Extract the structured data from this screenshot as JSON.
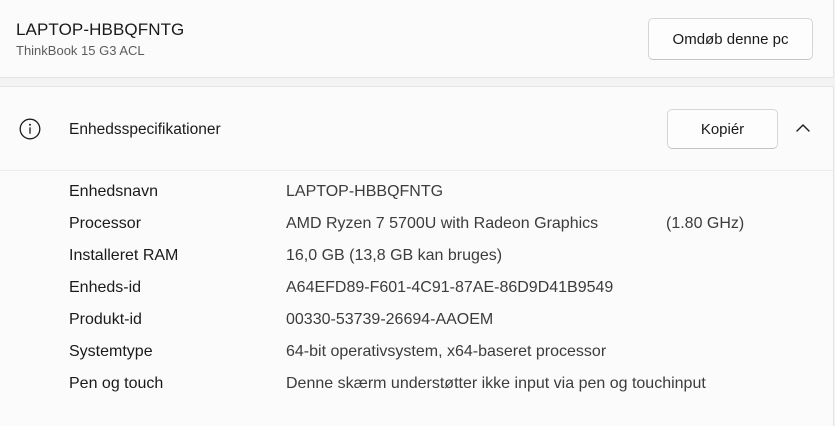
{
  "device": {
    "name": "LAPTOP-HBBQFNTG",
    "model": "ThinkBook 15 G3 ACL",
    "rename_label": "Omdøb denne pc"
  },
  "specs": {
    "title": "Enhedsspecifikationer",
    "info_icon": "info-icon",
    "copy_label": "Kopiér",
    "collapse_icon": "chevron-up-icon",
    "rows": [
      {
        "label": "Enhedsnavn",
        "value": "LAPTOP-HBBQFNTG",
        "extra": ""
      },
      {
        "label": "Processor",
        "value": "AMD Ryzen 7 5700U with Radeon Graphics",
        "extra": "(1.80 GHz)"
      },
      {
        "label": "Installeret RAM",
        "value": "16,0 GB (13,8 GB kan bruges)",
        "extra": ""
      },
      {
        "label": "Enheds-id",
        "value": "A64EFD89-F601-4C91-87AE-86D9D41B9549",
        "extra": ""
      },
      {
        "label": "Produkt-id",
        "value": "00330-53739-26694-AAOEM",
        "extra": ""
      },
      {
        "label": "Systemtype",
        "value": "64-bit operativsystem, x64-baseret processor",
        "extra": ""
      },
      {
        "label": "Pen og touch",
        "value": "Denne skærm understøtter ikke input via pen og touchinput",
        "extra": ""
      }
    ]
  }
}
